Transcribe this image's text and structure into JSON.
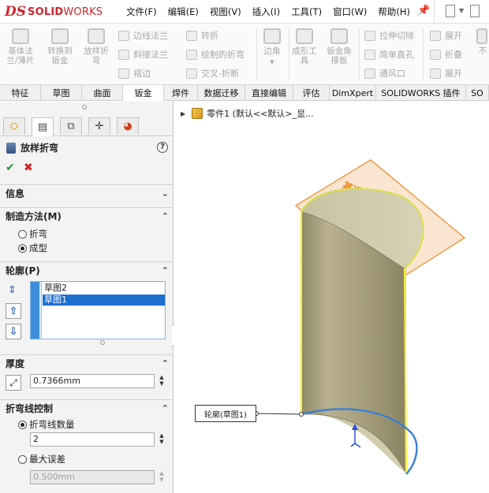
{
  "app": {
    "logo_ds": "DS",
    "logo_solid": "SOLID",
    "logo_works": "WORKS"
  },
  "menu": [
    "文件(F)",
    "编辑(E)",
    "视图(V)",
    "插入(I)",
    "工具(T)",
    "窗口(W)",
    "帮助(H)"
  ],
  "ribbon": {
    "big_buttons": [
      {
        "label": "基体法\n兰/薄片",
        "icon": "base-flange-icon"
      },
      {
        "label": "转换到\n钣金",
        "icon": "convert-to-sheet-metal-icon"
      },
      {
        "label": "放样折\n弯",
        "icon": "lofted-bend-icon"
      }
    ],
    "col1": [
      {
        "label": "边线法兰",
        "icon": "edge-flange-icon"
      },
      {
        "label": "斜接法兰",
        "icon": "miter-flange-icon"
      },
      {
        "label": "褶边",
        "icon": "hem-icon"
      }
    ],
    "col2": [
      {
        "label": "转折",
        "icon": "jog-icon"
      },
      {
        "label": "绘制的折弯",
        "icon": "sketched-bend-icon"
      },
      {
        "label": "交叉-折断",
        "icon": "cross-break-icon"
      }
    ],
    "mid_buttons": [
      {
        "label": "边角",
        "icon": "corners-icon"
      },
      {
        "label": "成形工\n具",
        "icon": "forming-tool-icon"
      },
      {
        "label": "钣金角\n撑板",
        "icon": "sheet-metal-gusset-icon"
      }
    ],
    "col3": [
      {
        "label": "拉伸切除",
        "icon": "extruded-cut-icon"
      },
      {
        "label": "简单直孔",
        "icon": "simple-hole-icon"
      },
      {
        "label": "通风口",
        "icon": "vent-icon"
      }
    ],
    "col4": [
      {
        "label": "展开",
        "icon": "unfold-icon"
      },
      {
        "label": "折叠",
        "icon": "fold-icon"
      },
      {
        "label": "展开",
        "icon": "flatten-icon"
      }
    ],
    "cut_label": "不"
  },
  "command_tabs": [
    "特征",
    "草图",
    "曲面",
    "钣金",
    "焊件",
    "数据迁移",
    "直接编辑",
    "评估",
    "DimXpert",
    "SOLIDWORKS 插件",
    "SO"
  ],
  "active_tab": "钣金",
  "pm": {
    "title": "放样折弯",
    "help": "?",
    "ok": "✔",
    "cancel": "✖",
    "sections": {
      "info": "信息",
      "method": "制造方法(M)",
      "profile": "轮廓(P)",
      "thickness": "厚度",
      "bendline": "折弯线控制"
    },
    "method_options": [
      {
        "label": "折弯",
        "selected": false
      },
      {
        "label": "成型",
        "selected": true
      }
    ],
    "profiles": [
      {
        "label": "草图2",
        "selected": false
      },
      {
        "label": "草图1",
        "selected": true
      }
    ],
    "thickness_value": "0.7366mm",
    "bend_options": [
      {
        "label": "折弯线数量",
        "selected": true,
        "value": "2"
      },
      {
        "label": "最大误差",
        "selected": false,
        "value": "0.500mm"
      }
    ]
  },
  "graphics": {
    "tree_label": "零件1  (默认<<默认>_显...",
    "plane_label": "基准面1",
    "callout_label": "轮廓(草图1)"
  },
  "colors": {
    "accent_blue": "#1e6fd0",
    "plane_orange": "#f08a24",
    "surface": "#b6ae8a",
    "edge_yellow": "#f6ee33",
    "edge_blue": "#3a7fd6"
  }
}
